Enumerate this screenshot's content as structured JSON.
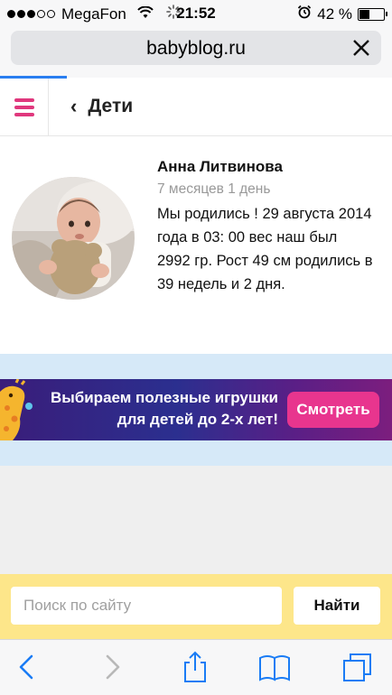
{
  "status_bar": {
    "carrier": "MegaFon",
    "time": "21:52",
    "battery_percent": "42 %",
    "battery_level": 0.42,
    "signal_bars_filled": 3,
    "signal_bars_total": 5
  },
  "browser": {
    "url": "babyblog.ru",
    "load_progress": 0.17
  },
  "header": {
    "back_label": "Дети"
  },
  "profile": {
    "name": "Анна Литвинова",
    "age": "7 месяцев 1 день",
    "bio": "Мы родились ! 29 августа 2014 года в 03: 00 вес наш был 2992 гр. Рост 49 см родились в 39 недель и 2 дня."
  },
  "ad": {
    "line1": "Выбираем полезные игрушки",
    "line2": "для детей до 2-х лет!",
    "button": "Смотреть"
  },
  "search": {
    "placeholder": "Поиск по сайту",
    "button": "Найти"
  },
  "colors": {
    "accent": "#e0387d",
    "search_bg": "#fde68a",
    "ad_button": "#e8358e",
    "safari_blue": "#1a7cf5"
  },
  "toolbar": {
    "icons": [
      "back-icon",
      "forward-icon",
      "share-icon",
      "bookmarks-icon",
      "tabs-icon"
    ]
  }
}
